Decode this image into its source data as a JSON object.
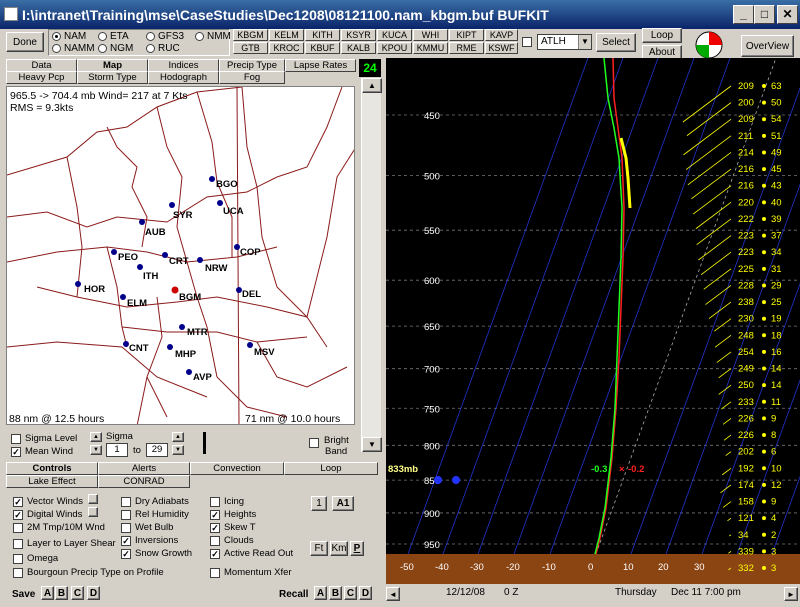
{
  "window": {
    "title": "I:\\intranet\\Training\\mse\\CaseStudies\\Dec1208\\08121100.nam_kbgm.buf BUFKIT",
    "min": "_",
    "max": "□",
    "close": "✕"
  },
  "toolbar": {
    "done": "Done",
    "models": [
      {
        "label": "NAM",
        "selected": true
      },
      {
        "label": "ETA",
        "selected": false
      },
      {
        "label": "GFS3",
        "selected": false
      },
      {
        "label": "NMM",
        "selected": false
      },
      {
        "label": "NAMM",
        "selected": false
      },
      {
        "label": "NGM",
        "selected": false
      },
      {
        "label": "RUC",
        "selected": false
      }
    ],
    "stations": [
      "KBGM",
      "KELM",
      "KITH",
      "KSYR",
      "KUCA",
      "WHI",
      "KIPT",
      "KAVP",
      "GTB",
      "KROC",
      "KBUF",
      "KALB",
      "KPOU",
      "KMMU",
      "RME",
      "KSWF"
    ],
    "site_select": "ATLH",
    "select": "Select",
    "loop": "Loop",
    "about": "About",
    "overview": "OverView"
  },
  "tabs_row1": [
    "Data",
    "Map",
    "Indices",
    "Precip Type",
    "Lapse Rates"
  ],
  "tabs_row2": [
    "Heavy Pcp",
    "Storm Type",
    "Hodograph",
    "Fog"
  ],
  "frame_count": "24",
  "map": {
    "info_line1": "965.5 -> 704.4 mb Wind=  217 at 7 Kts",
    "info_line2": "RMS = 9.3kts",
    "left_scale": "88 nm @ 12.5 hours",
    "right_scale": "71 nm @ 10.0 hours",
    "stations": [
      "BGO",
      "SYR",
      "UCA",
      "AUB",
      "COP",
      "PEO",
      "CRT",
      "NRW",
      "ITH",
      "HOR",
      "BGM",
      "DEL",
      "ELM",
      "MTR",
      "CNT",
      "MHP",
      "MSV",
      "AVP"
    ]
  },
  "map_controls": {
    "sigma_level": "Sigma Level",
    "mean_wind": "Mean Wind",
    "sigma": "Sigma",
    "sigma_from": "1",
    "to": "to",
    "sigma_to": "29",
    "bright": "Bright",
    "band": "Band"
  },
  "ctrl_tabs": [
    "Controls",
    "Alerts",
    "Convection",
    "Loop",
    "Lake Effect",
    "CONRAD"
  ],
  "options": {
    "col1": [
      {
        "label": "Vector Winds",
        "checked": true
      },
      {
        "label": "Digital Winds",
        "checked": true
      },
      {
        "label": "2M Tmp/10M Wnd",
        "checked": false
      },
      {
        "label": "Layer to Layer Shear",
        "checked": false
      },
      {
        "label": "Omega",
        "checked": false
      },
      {
        "label": "Bourgoun  Precip Type on Profile",
        "checked": false
      }
    ],
    "col2": [
      {
        "label": "Dry Adiabats",
        "checked": false
      },
      {
        "label": "Rel Humidity",
        "checked": false
      },
      {
        "label": "Wet Bulb",
        "checked": false
      },
      {
        "label": "Inversions",
        "checked": true
      },
      {
        "label": "Snow Growth",
        "checked": true
      }
    ],
    "col3": [
      {
        "label": "Icing",
        "checked": false
      },
      {
        "label": "Heights",
        "checked": true
      },
      {
        "label": "Skew T",
        "checked": true
      },
      {
        "label": "Clouds",
        "checked": false
      },
      {
        "label": "Active Read Out",
        "checked": true
      },
      {
        "label": "Momentum Xfer",
        "checked": false
      }
    ],
    "btn_1": "1",
    "btn_a1": "A1",
    "ft": "Ft",
    "km": "Km",
    "p": "P"
  },
  "bottom": {
    "save": "Save",
    "recall": "Recall",
    "letters": [
      "A",
      "B",
      "C",
      "D"
    ]
  },
  "sounding": {
    "pressures": [
      "450",
      "500",
      "550",
      "600",
      "650",
      "700",
      "750",
      "800",
      "850",
      "900",
      "950"
    ],
    "temps": [
      "-50",
      "-40",
      "-30",
      "-20",
      "-10",
      "0",
      "10",
      "20",
      "30"
    ],
    "footer_date": "12/12/08",
    "footer_z": "0 Z",
    "footer_day": "Thursday",
    "footer_local": "Dec 11  7:00 pm",
    "cursor_p": "833mb",
    "dewpt_readout": "-0.3",
    "temp_readout": "-0.2",
    "wind_table": [
      [
        "209",
        "63"
      ],
      [
        "200",
        "50"
      ],
      [
        "209",
        "54"
      ],
      [
        "211",
        "51"
      ],
      [
        "214",
        "49"
      ],
      [
        "216",
        "45"
      ],
      [
        "216",
        "43"
      ],
      [
        "220",
        "40"
      ],
      [
        "222",
        "39"
      ],
      [
        "223",
        "37"
      ],
      [
        "223",
        "34"
      ],
      [
        "225",
        "31"
      ],
      [
        "228",
        "29"
      ],
      [
        "238",
        "25"
      ],
      [
        "230",
        "19"
      ],
      [
        "248",
        "18"
      ],
      [
        "254",
        "16"
      ],
      [
        "249",
        "14"
      ],
      [
        "250",
        "14"
      ],
      [
        "233",
        "11"
      ],
      [
        "226",
        "9"
      ],
      [
        "226",
        "8"
      ],
      [
        "202",
        "6"
      ],
      [
        "192",
        "10"
      ],
      [
        "174",
        "12"
      ],
      [
        "158",
        "9"
      ],
      [
        "121",
        "4"
      ],
      [
        "34",
        "2"
      ],
      [
        "339",
        "3"
      ],
      [
        "332",
        "3"
      ]
    ]
  },
  "colors": {
    "temp": "#ff2020",
    "dewpt": "#20ff20",
    "wind": "#ffff00",
    "ground": "#8b4513"
  }
}
